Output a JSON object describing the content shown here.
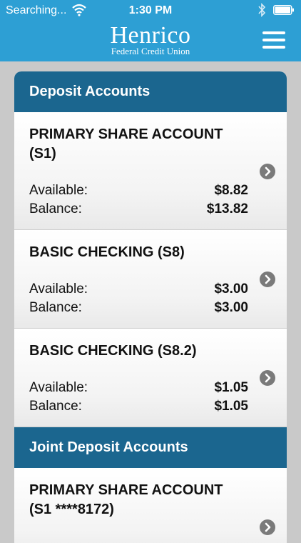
{
  "status": {
    "carrier": "Searching...",
    "time": "1:30 PM"
  },
  "brand": {
    "name": "Henrico",
    "sub": "Federal Credit Union"
  },
  "colors": {
    "header": "#2d9fd4",
    "section": "#1b668f"
  },
  "deposit": {
    "title": "Deposit Accounts",
    "accounts": [
      {
        "name_line1": "PRIMARY SHARE ACCOUNT",
        "name_line2": "(S1)",
        "available_label": "Available:",
        "available": "$8.82",
        "balance_label": "Balance:",
        "balance": "$13.82"
      },
      {
        "name_line1": "BASIC CHECKING (S8)",
        "available_label": "Available:",
        "available": "$3.00",
        "balance_label": "Balance:",
        "balance": "$3.00"
      },
      {
        "name_line1": "BASIC CHECKING (S8.2)",
        "available_label": "Available:",
        "available": "$1.05",
        "balance_label": "Balance:",
        "balance": "$1.05"
      }
    ]
  },
  "joint": {
    "title": "Joint Deposit Accounts",
    "accounts": [
      {
        "name_line1": "PRIMARY SHARE ACCOUNT",
        "name_line2": "(S1 ****8172)"
      }
    ]
  }
}
